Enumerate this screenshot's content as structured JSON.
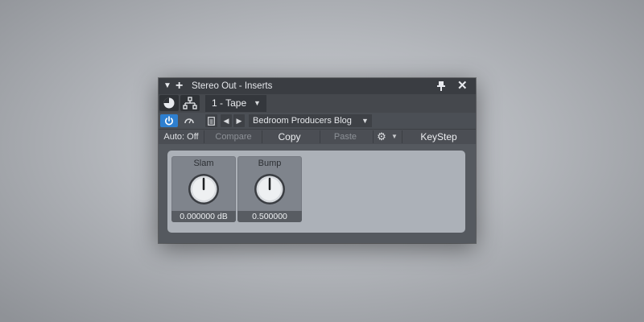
{
  "window": {
    "title": "Stereo Out - Inserts"
  },
  "toolbar": {
    "preset": "1 - Tape"
  },
  "plugin_bar": {
    "plugin_name": "Bedroom Producers Blog"
  },
  "actions": {
    "automation": "Auto: Off",
    "compare": "Compare",
    "copy": "Copy",
    "paste": "Paste",
    "keystep": "KeyStep"
  },
  "knobs": [
    {
      "label": "Slam",
      "value": "0.000000 dB",
      "level": 0.0
    },
    {
      "label": "Bump",
      "value": "0.500000",
      "level": 0.5
    }
  ],
  "colors": {
    "power_active": "#2e7fcf",
    "titlebar": "#3a3d42",
    "plugin_panel": "#acb1b8",
    "knob_module": "#7f848c"
  },
  "icons": {
    "menu": "triangle-down-icon",
    "add": "plus-icon",
    "pin": "pin-icon",
    "close": "x-icon",
    "power": "power-icon"
  }
}
